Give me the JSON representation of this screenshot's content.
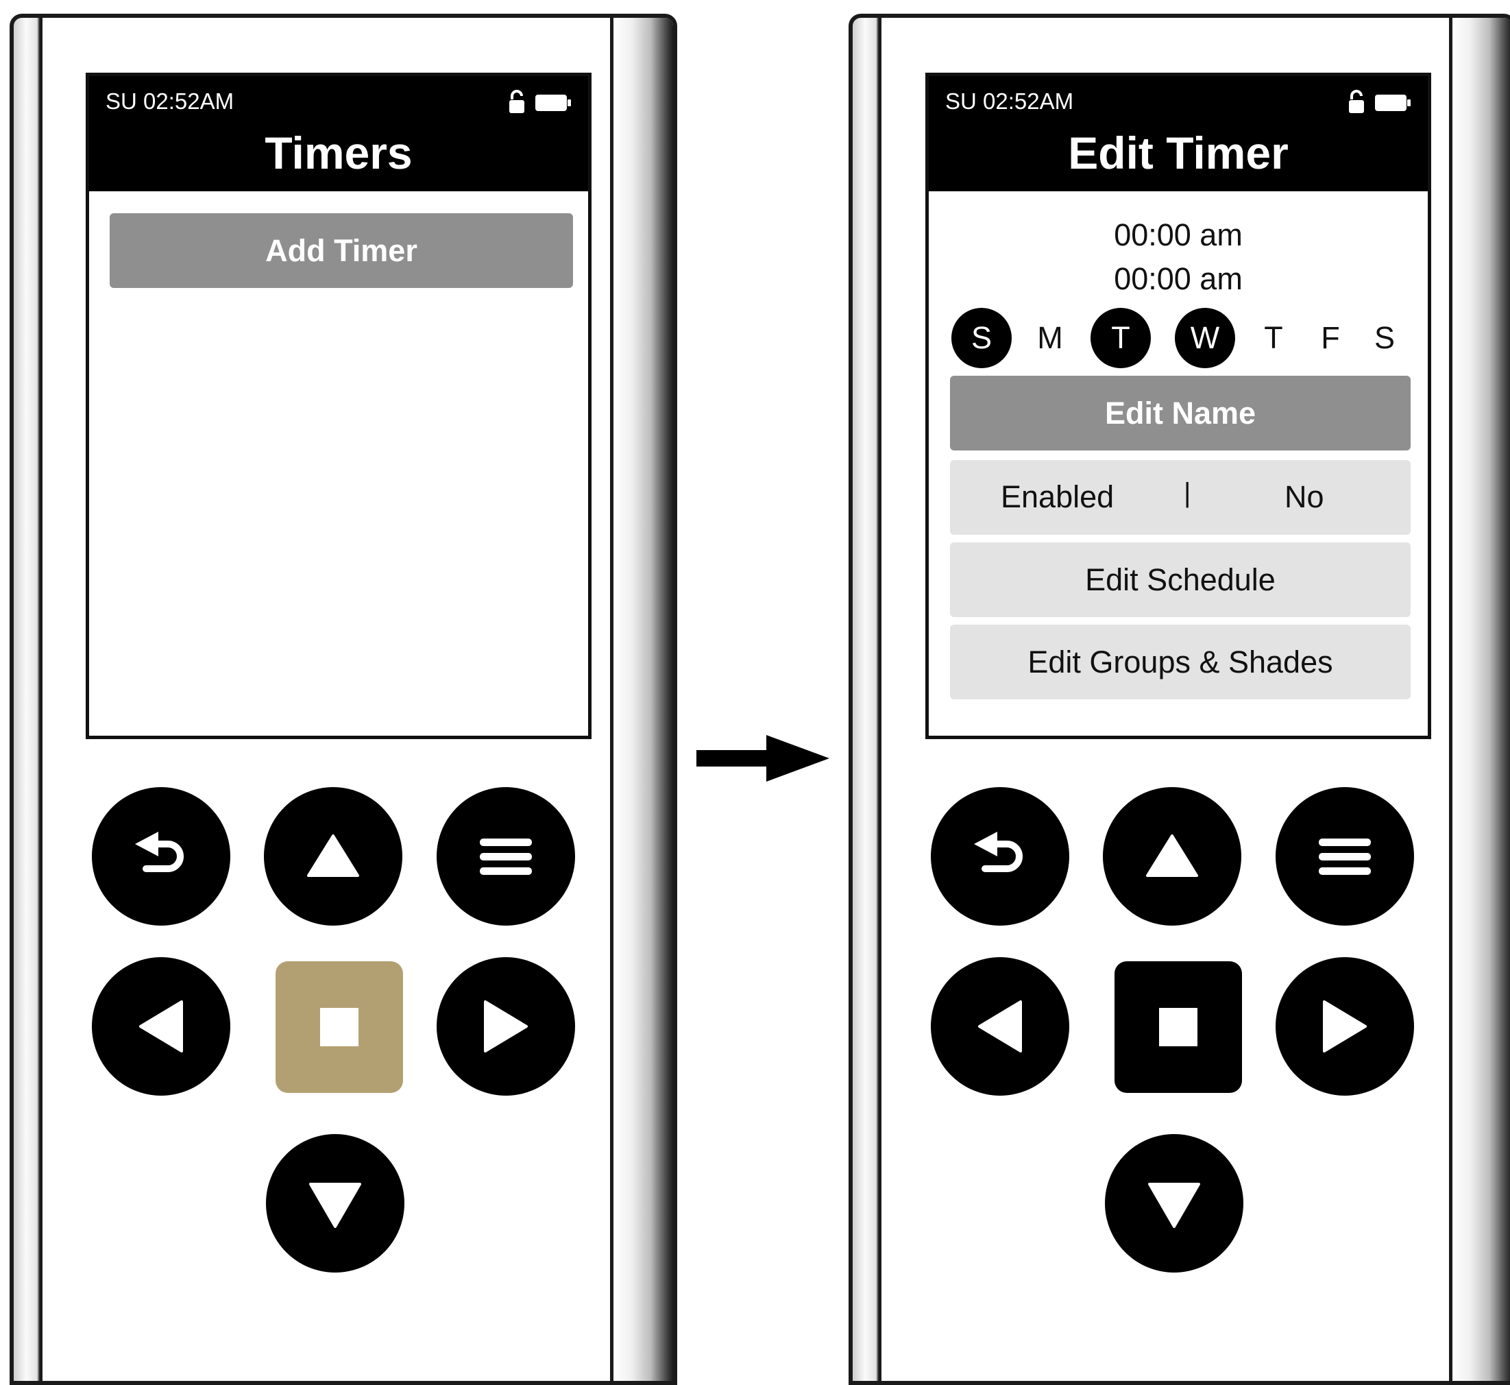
{
  "left_screen": {
    "status_time": "SU 02:52AM",
    "title": "Timers",
    "add_button": "Add Timer"
  },
  "right_screen": {
    "status_time": "SU 02:52AM",
    "title": "Edit Timer",
    "start_time": "00:00 am",
    "end_time": "00:00 am",
    "days": [
      {
        "label": "S",
        "selected": true
      },
      {
        "label": "M",
        "selected": false
      },
      {
        "label": "T",
        "selected": true
      },
      {
        "label": "W",
        "selected": true
      },
      {
        "label": "T",
        "selected": false
      },
      {
        "label": "F",
        "selected": false
      },
      {
        "label": "S",
        "selected": false
      }
    ],
    "edit_name_button": "Edit Name",
    "enabled_label": "Enabled",
    "enabled_separator": "|",
    "enabled_value": "No",
    "edit_schedule_button": "Edit Schedule",
    "edit_groups_button": "Edit Groups & Shades"
  },
  "controls": {
    "icons": [
      "back-icon",
      "up-arrow-icon",
      "menu-icon",
      "left-arrow-icon",
      "select-icon",
      "right-arrow-icon",
      "down-arrow-icon"
    ],
    "select_color_left": "#b3a072",
    "select_color_right": "#000000"
  },
  "colors": {
    "header": "#000000",
    "primary_button": "#8f8f8f",
    "secondary_button": "#e3e3e3",
    "day_selected": "#000000"
  }
}
